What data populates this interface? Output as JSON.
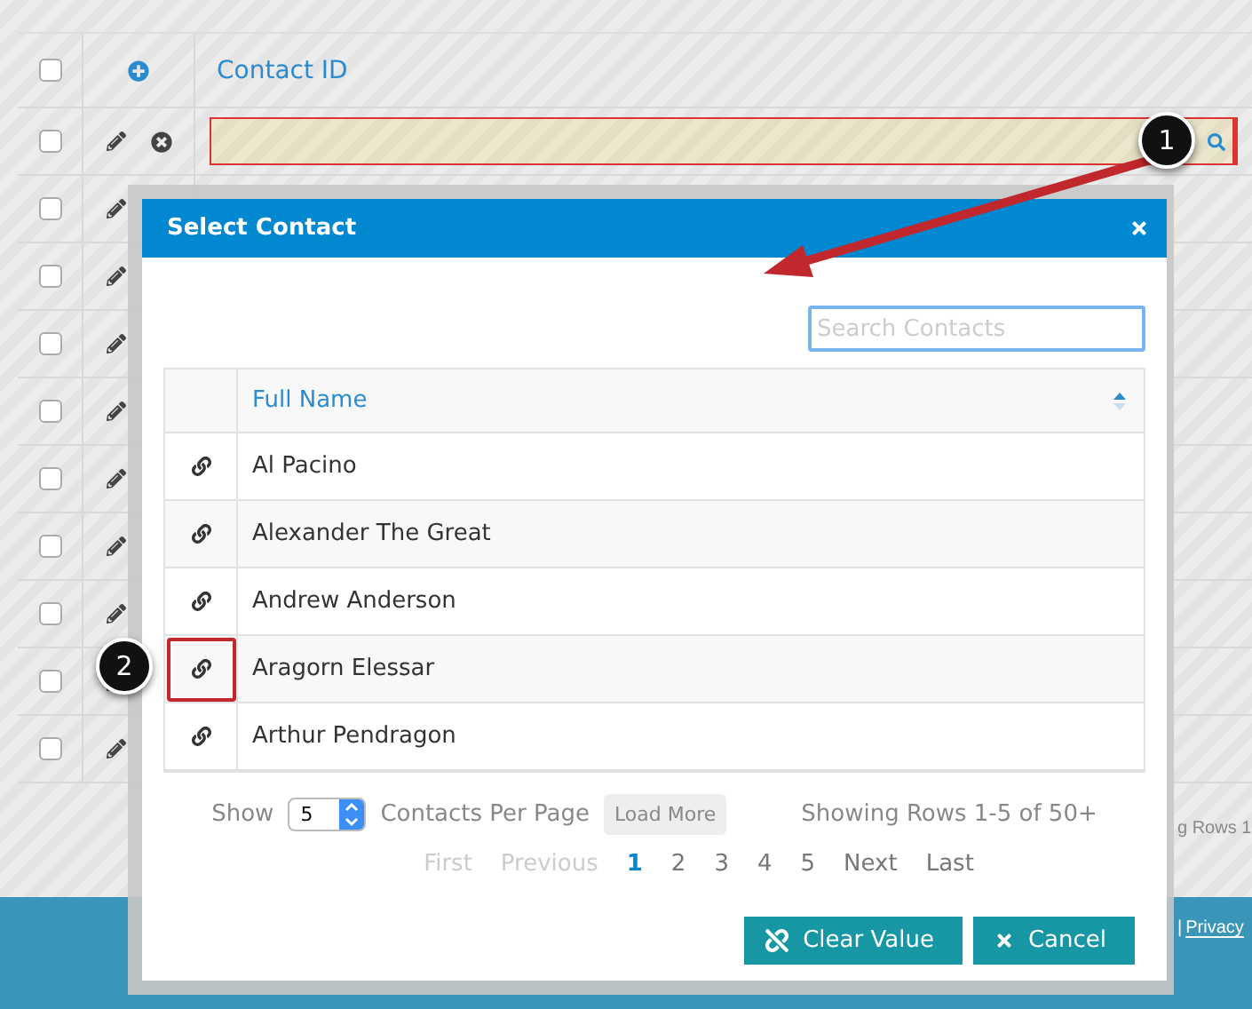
{
  "grid": {
    "column": "Contact ID",
    "header_checked": false,
    "rows": [
      {
        "checked": false,
        "editing": true
      },
      {
        "checked": false,
        "editing": false
      },
      {
        "checked": false,
        "editing": false
      },
      {
        "checked": false,
        "editing": false
      },
      {
        "checked": false,
        "editing": false
      },
      {
        "checked": false,
        "editing": false
      },
      {
        "checked": false,
        "editing": false
      },
      {
        "checked": false,
        "editing": false
      },
      {
        "checked": false,
        "editing": false
      },
      {
        "checked": false,
        "editing": false
      }
    ],
    "status_fragment": "g Rows 1"
  },
  "footer": {
    "link": "Privacy",
    "separator": "|"
  },
  "dialog": {
    "title": "Select Contact",
    "search": {
      "placeholder": "Search Contacts"
    },
    "column": "Full Name",
    "contacts": [
      {
        "name": "Al Pacino",
        "highlighted": false
      },
      {
        "name": "Alexander The Great",
        "highlighted": false
      },
      {
        "name": "Andrew Anderson",
        "highlighted": false
      },
      {
        "name": "Aragorn Elessar",
        "highlighted": true
      },
      {
        "name": "Arthur Pendragon",
        "highlighted": false
      }
    ],
    "show_label": "Show",
    "per_page": "5",
    "per_page_label": "Contacts Per Page",
    "load_more": "Load More",
    "summary": "Showing Rows 1-5 of 50+",
    "pages": [
      {
        "label": "First",
        "disabled": true,
        "selected": false
      },
      {
        "label": "Previous",
        "disabled": true,
        "selected": false
      },
      {
        "label": "1",
        "disabled": false,
        "selected": true
      },
      {
        "label": "2",
        "disabled": false,
        "selected": false
      },
      {
        "label": "3",
        "disabled": false,
        "selected": false
      },
      {
        "label": "4",
        "disabled": false,
        "selected": false
      },
      {
        "label": "5",
        "disabled": false,
        "selected": false
      },
      {
        "label": "Next",
        "disabled": false,
        "selected": false
      },
      {
        "label": "Last",
        "disabled": false,
        "selected": false
      }
    ],
    "buttons": [
      {
        "label": "Clear Value",
        "kind": "clear"
      },
      {
        "label": "Cancel",
        "kind": "cancel"
      }
    ]
  },
  "callouts": [
    "1",
    "2"
  ]
}
